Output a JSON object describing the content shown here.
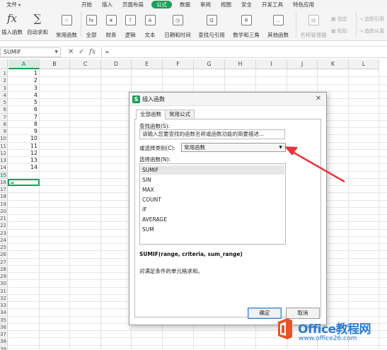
{
  "menubar": {
    "items": [
      {
        "label": "文件"
      },
      {
        "label": "开始"
      },
      {
        "label": "插入"
      },
      {
        "label": "页面布局"
      },
      {
        "label": "公式"
      },
      {
        "label": "数据"
      },
      {
        "label": "审阅"
      },
      {
        "label": "视图"
      },
      {
        "label": "安全"
      },
      {
        "label": "开发工具"
      },
      {
        "label": "特色应用"
      }
    ],
    "active": "公式"
  },
  "ribbon": {
    "buttons": [
      {
        "icon": "fx",
        "label": "插入函数"
      },
      {
        "icon": "∑",
        "label": "自动求和"
      },
      {
        "icon": "☆",
        "label": "常用函数"
      },
      {
        "icon": "fx",
        "label": "全部"
      },
      {
        "icon": "¥",
        "label": "财务"
      },
      {
        "icon": "?",
        "label": "逻辑"
      },
      {
        "icon": "A",
        "label": "文本"
      },
      {
        "icon": "◷",
        "label": "日期和时间"
      },
      {
        "icon": "Q",
        "label": "查找与引用"
      },
      {
        "icon": "θ",
        "label": "数学和三角"
      },
      {
        "icon": "…",
        "label": "其他函数"
      },
      {
        "icon": "▤",
        "label": "名称管理器"
      }
    ],
    "small_items": [
      "指定",
      "粘贴",
      "追踪引用",
      "追踪从属"
    ]
  },
  "formula_bar": {
    "name_box": "SUMIF",
    "cancel_icon": "✕",
    "enter_icon": "✓",
    "fx_icon": "fx",
    "content": "="
  },
  "grid": {
    "columns": [
      "A",
      "B",
      "C",
      "D",
      "E",
      "F",
      "G",
      "H",
      "I",
      "J",
      "K",
      "L"
    ],
    "active_column": "A",
    "rows": [
      "1",
      "2",
      "3",
      "4",
      "5",
      "6",
      "7",
      "8",
      "9",
      "10",
      "11",
      "12",
      "13",
      "14",
      "15",
      "16",
      "17",
      "18",
      "19",
      "20",
      "21",
      "22",
      "23",
      "24",
      "25",
      "26",
      "27",
      "28",
      "29",
      "30",
      "31",
      "32",
      "33",
      "34",
      "35",
      "36",
      "37",
      "38",
      "39"
    ],
    "column_a_values": [
      "1",
      "2",
      "3",
      "4",
      "5",
      "6",
      "7",
      "8",
      "9",
      "10",
      "11",
      "12",
      "13",
      "14"
    ],
    "active_row": "15",
    "active_cell_value": "="
  },
  "dialog": {
    "title": "插入函数",
    "logo": "S",
    "close_icon": "✕",
    "tabs": [
      "全部函数",
      "常用公式"
    ],
    "search_label": "查找函数(S):",
    "search_placeholder": "请输入您要查找的函数名称或函数功能的简要描述...",
    "category_label": "或选择类别(C):",
    "category_value": "常用函数",
    "category_dropdown_icon": "▼",
    "select_label": "选择函数(N):",
    "functions": [
      "SUMIF",
      "SIN",
      "MAX",
      "COUNT",
      "IF",
      "AVERAGE",
      "SUM"
    ],
    "selected_function": "SUMIF",
    "signature": "SUMIF(range, criteria, sum_range)",
    "description": "对满足条件的单元格求和。",
    "ok_label": "确定",
    "cancel_label": "取消"
  },
  "watermark": {
    "brand": "Office教程网",
    "url": "www.office26.com",
    "logo_color": "#e8532a"
  },
  "colors": {
    "accent": "#1aa05a",
    "arrow": "#e8343c"
  }
}
